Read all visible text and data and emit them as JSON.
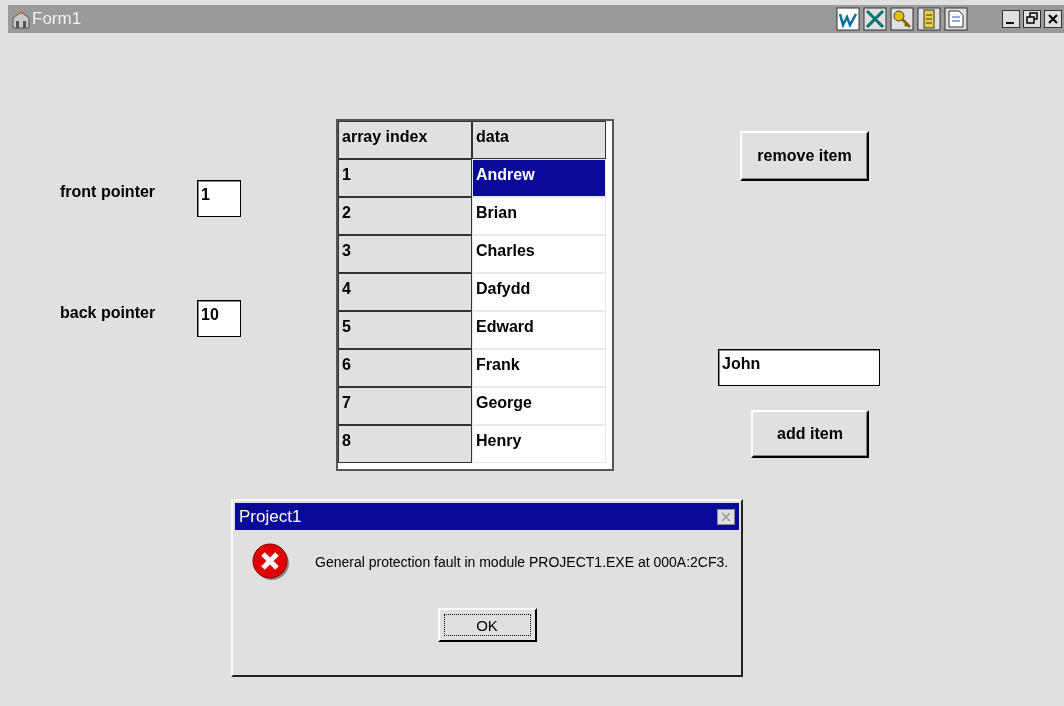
{
  "window": {
    "title": "Form1"
  },
  "fields": [
    {
      "label": "front pointer",
      "value": "1"
    },
    {
      "label": "back pointer",
      "value": "10"
    }
  ],
  "grid": {
    "columns": [
      "array index",
      "data"
    ],
    "rows": [
      {
        "index": "1",
        "data": "Andrew",
        "selected": true
      },
      {
        "index": "2",
        "data": "Brian",
        "selected": false
      },
      {
        "index": "3",
        "data": "Charles",
        "selected": false
      },
      {
        "index": "4",
        "data": "Dafydd",
        "selected": false
      },
      {
        "index": "5",
        "data": "Edward",
        "selected": false
      },
      {
        "index": "6",
        "data": "Frank",
        "selected": false
      },
      {
        "index": "7",
        "data": "George",
        "selected": false
      },
      {
        "index": "8",
        "data": "Henry",
        "selected": false
      }
    ]
  },
  "remove_button": "remove item",
  "item_field": {
    "value": "John"
  },
  "add_button": "add item",
  "dialog": {
    "title": "Project1",
    "message": "General protection fault in module PROJECT1.EXE at 000A:2CF3.",
    "button": "OK"
  }
}
